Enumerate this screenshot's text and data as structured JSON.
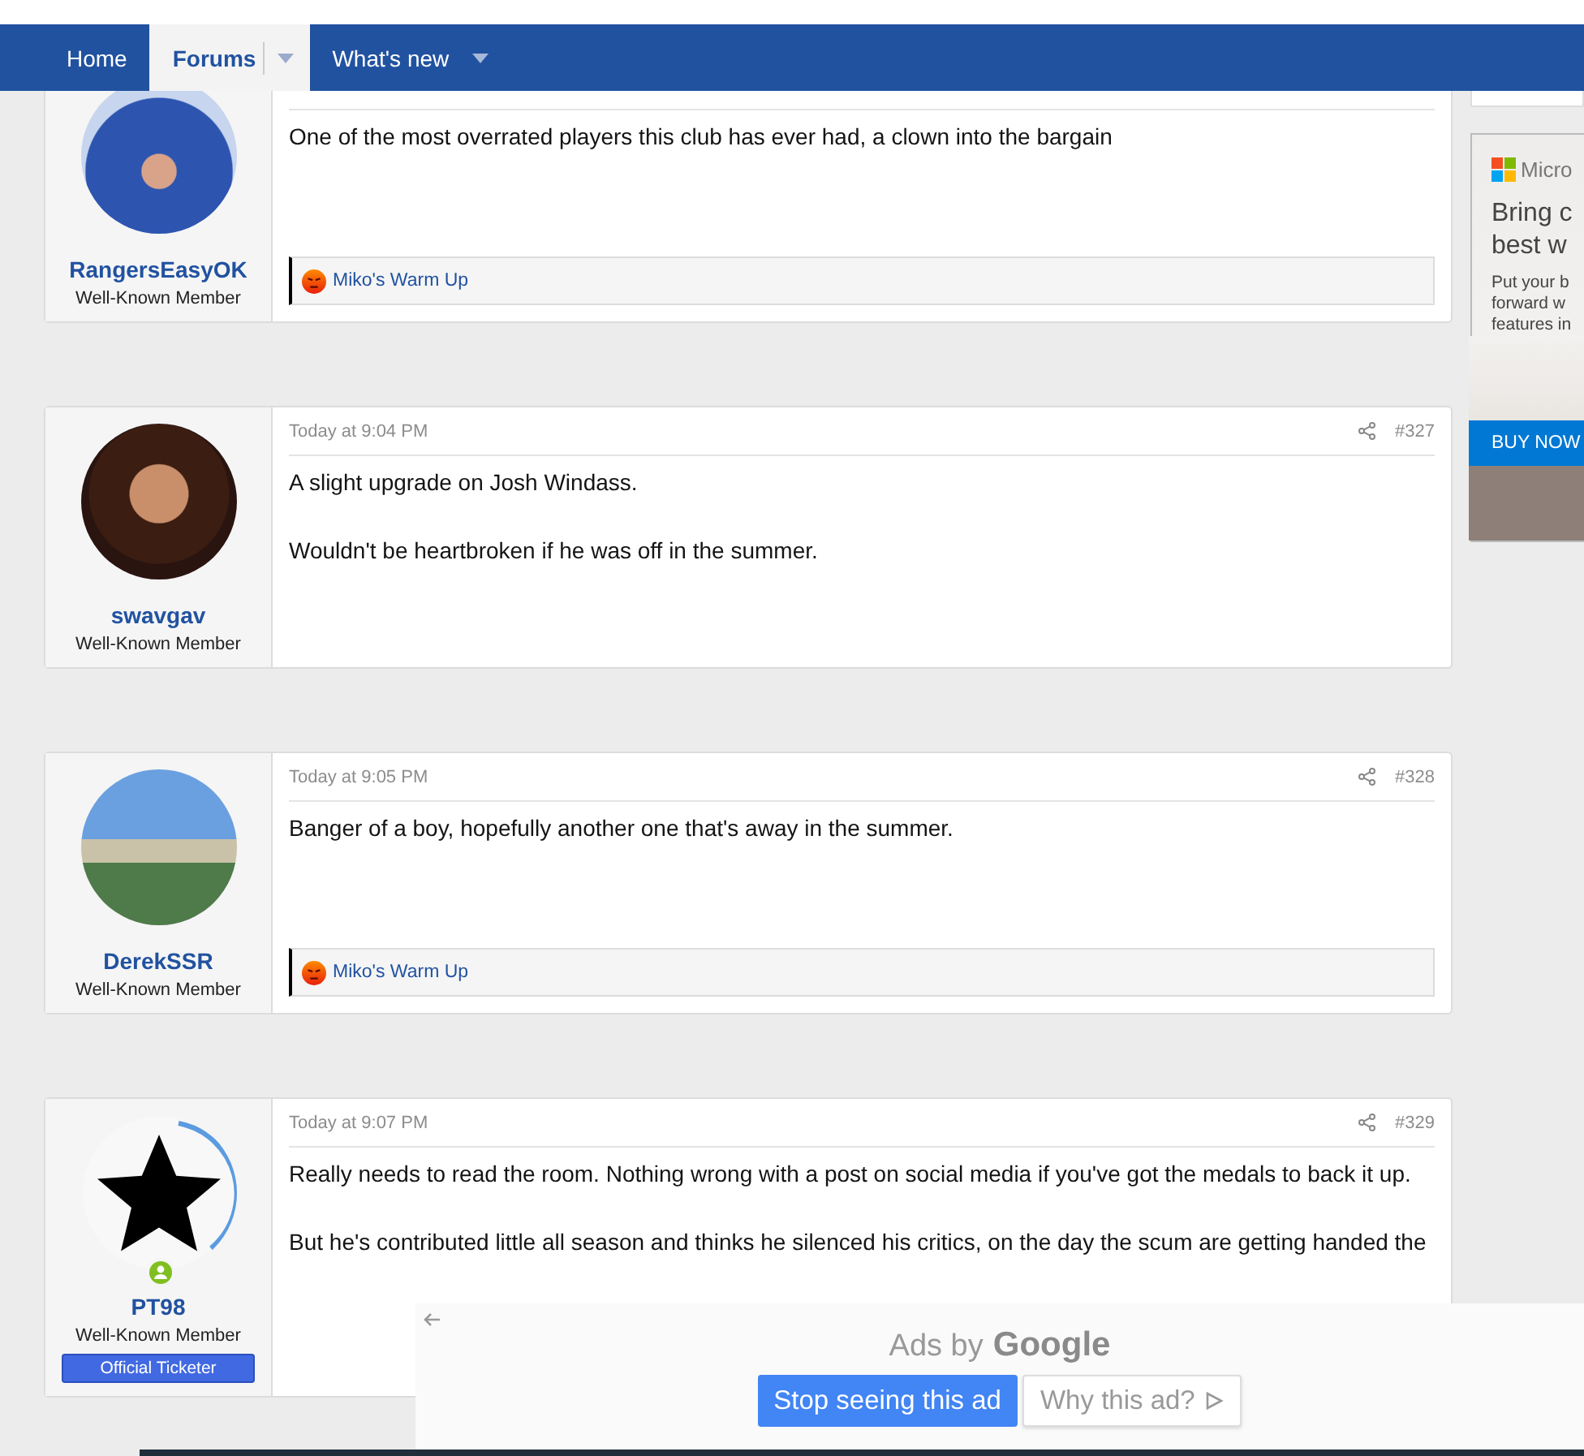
{
  "nav": {
    "tabs": [
      {
        "label": "Home",
        "selected": false,
        "dropdown": false
      },
      {
        "label": "Forums",
        "selected": true,
        "dropdown": true
      },
      {
        "label": "What's new",
        "selected": false,
        "dropdown": true
      }
    ]
  },
  "posts": [
    {
      "kind": "photo",
      "online": false,
      "user": "RangersEasyOK",
      "user_title": "Well-Known Member",
      "paragraphs": [
        "One of the most overrated players this club has ever had, a clown into the bargain"
      ],
      "reaction": "Miko's Warm Up"
    },
    {
      "kind": "photo",
      "online": false,
      "user": "swavgav",
      "user_title": "Well-Known Member",
      "date": "Today at 9:04 PM",
      "number": "#327",
      "paragraphs": [
        "A slight upgrade on Josh Windass.",
        "Wouldn't be heartbroken if he was off in the summer."
      ]
    },
    {
      "kind": "photo",
      "online": false,
      "user": "DerekSSR",
      "user_title": "Well-Known Member",
      "date": "Today at 9:05 PM",
      "number": "#328",
      "paragraphs": [
        "Banger of a boy, hopefully another one that's away in the summer."
      ],
      "reaction": "Miko's Warm Up"
    },
    {
      "kind": "star",
      "online": true,
      "user": "PT98",
      "user_title": "Well-Known Member",
      "banner": "Official Ticketer",
      "date": "Today at 9:07 PM",
      "number": "#329",
      "paragraphs": [
        "Really needs to read the room. Nothing wrong with a post on social media if you've got the medals to back it up.",
        "But he's contributed little all season and thinks he silenced his critics, on the day the scum are getting handed the"
      ]
    }
  ],
  "side_ad": {
    "brand": "Micro",
    "headline": [
      "Bring c",
      "best w"
    ],
    "body": [
      "Put your b",
      "forward w",
      "features in"
    ],
    "button": "BUY NOW"
  },
  "ad_overlay": {
    "label": "Ads by",
    "brand": "Google",
    "buttons": [
      {
        "label": "Stop seeing this ad",
        "kind": "primary"
      },
      {
        "label": "Why this ad?",
        "kind": "secondary"
      }
    ]
  }
}
